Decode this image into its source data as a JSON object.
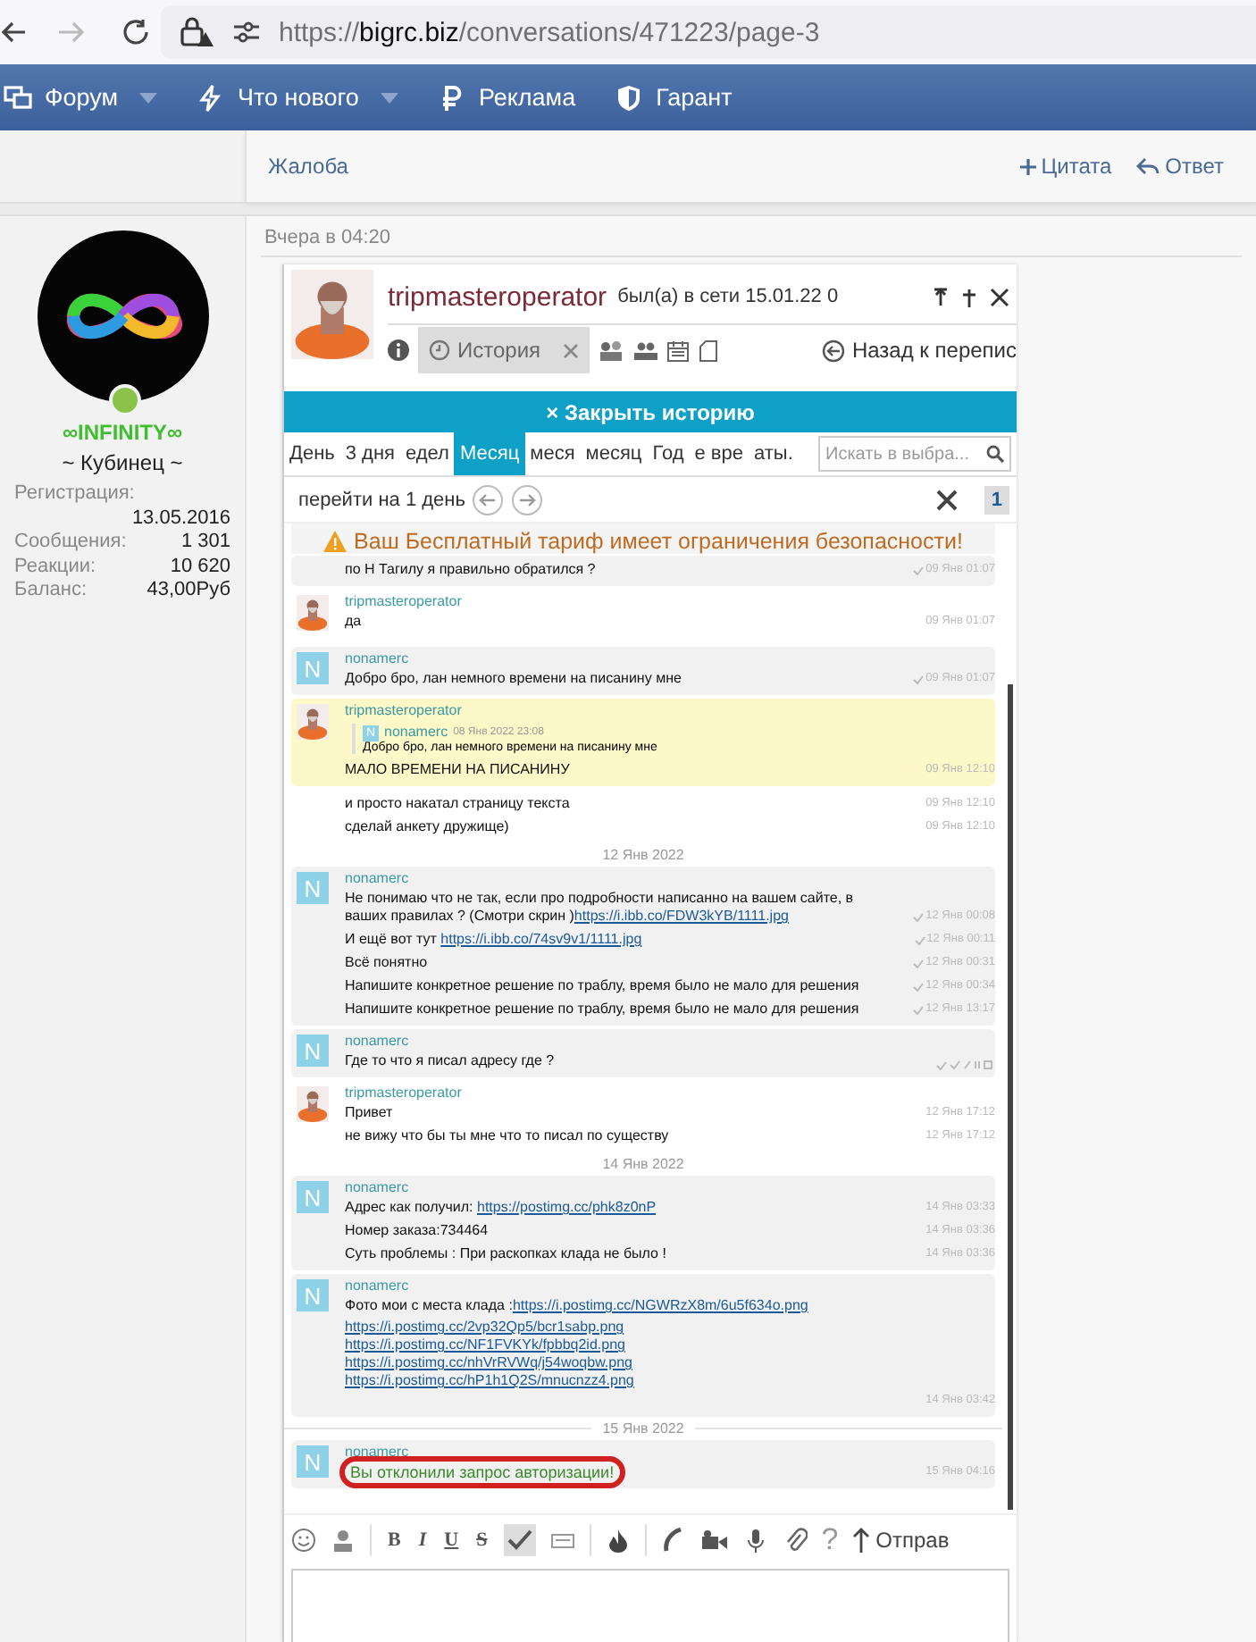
{
  "browser": {
    "url_scheme": "https://",
    "url_domain": "bigrc.biz",
    "url_path": "/conversations/471223/page-3",
    "forward_disabled": true
  },
  "nav": [
    {
      "label": "Форум",
      "dropdown": true
    },
    {
      "label": "Что нового",
      "dropdown": true
    },
    {
      "label": "Реклама",
      "dropdown": false
    },
    {
      "label": "Гарант",
      "dropdown": false
    }
  ],
  "prev_post": {
    "report": "Жалоба",
    "quote": "Цитата",
    "reply": "Ответ"
  },
  "user": {
    "name": "∞INFINITY∞",
    "title": "~ Кубинец ~",
    "online": true,
    "stats": [
      {
        "label": "Регистрация:",
        "value": "13.05.2016",
        "kind": "stacked"
      },
      {
        "label": "Сообщения:",
        "value": "1 301",
        "kind": "inline"
      },
      {
        "label": "Реакции:",
        "value": "10 620",
        "kind": "inline"
      },
      {
        "label": "Баланс:",
        "value": "43,00Руб",
        "kind": "inline"
      }
    ]
  },
  "post": {
    "date": "Вчера в 04:20"
  },
  "shot": {
    "contact": "tripmasteroperator",
    "status": "был(а) в сети 15.01.22 0",
    "history_tab": "История",
    "back": "Назад к перепис",
    "close_history": "× Закрыть историю",
    "periods": [
      {
        "label": "День",
        "selected": false
      },
      {
        "label": "3 дня",
        "selected": false
      },
      {
        "label": "едел",
        "selected": false
      },
      {
        "label": "Месяц",
        "selected": true
      },
      {
        "label": "меся",
        "selected": false
      },
      {
        "label": "месяц",
        "selected": false
      },
      {
        "label": "Год",
        "selected": false
      },
      {
        "label": "е вре",
        "selected": false
      },
      {
        "label": "аты.",
        "selected": false
      }
    ],
    "search": {
      "placeholder": "Искать в выбра..."
    },
    "jump": "перейти на 1 день",
    "page": "1",
    "warning": "Ваш Бесплатный тариф имеет ограничения безопасности!",
    "messages": [
      {
        "kind": "group",
        "highlighted": false,
        "shade": true,
        "lines": [
          {
            "text": "по Н Тагилу я правильно обратился ?",
            "time": "09 Янв 01:07",
            "read": true
          }
        ]
      },
      {
        "kind": "group",
        "sender": "tripmasteroperator",
        "avatar_picture": true,
        "highlighted": false,
        "shade": false,
        "lines": [
          {
            "text": "да",
            "time": "09 Янв 01:07",
            "read": false
          }
        ]
      },
      {
        "kind": "group",
        "sender": "nonamerc",
        "avatar_letter": "N",
        "highlighted": false,
        "shade": true,
        "lines": [
          {
            "text": "Добро бро, лан немного времени на писанину мне",
            "time": "09 Янв 01:07",
            "read": true
          }
        ]
      },
      {
        "kind": "group",
        "sender": "tripmasteroperator",
        "avatar_picture": true,
        "highlighted": true,
        "quote": {
          "letter": "N",
          "sender": "nonamerc",
          "time": "08 Янв 2022 23:08",
          "text": "Добро бро, лан немного времени на писанину мне"
        },
        "lines": [
          {
            "text": "МАЛО ВРЕМЕНИ НА ПИСАНИНУ",
            "time": "09 Янв 12:10",
            "read": false
          }
        ]
      },
      {
        "kind": "group",
        "highlighted": false,
        "shade": false,
        "lines": [
          {
            "text": "и просто накатал страницу текста",
            "time": "09 Янв 12:10",
            "read": false
          },
          {
            "text": "сделай анкету дружище)",
            "time": "09 Янв 12:10",
            "read": false
          }
        ]
      },
      {
        "kind": "date",
        "text": "12 Янв 2022"
      },
      {
        "kind": "group",
        "sender": "nonamerc",
        "avatar_letter": "N",
        "highlighted": false,
        "shade": true,
        "lines": [
          {
            "text": "Не понимаю что не так, если про подробности написанно на вашем сайте, в ваших правилах ? (Смотри скрин )",
            "link": "https://i.ibb.co/FDW3kYB/1111.jpg",
            "time": "12 Янв 00:08",
            "read": true
          },
          {
            "text": "И ещё вот тут ",
            "link": "https://i.ibb.co/74sv9v1/1111.jpg",
            "time": "12 Янв 00:11",
            "read": true
          },
          {
            "text": "Всё понятно",
            "time": "12 Янв 00:31",
            "read": true
          },
          {
            "text": "Напишите конкретное решение по траблу, время было не мало для решения",
            "time": "12 Янв 00:34",
            "read": true
          },
          {
            "text": "Напишите конкретное решение по траблу, время было не мало для решения",
            "time": "12 Янв 13:17",
            "read": true
          }
        ]
      },
      {
        "kind": "group",
        "sender": "nonamerc",
        "avatar_letter": "N",
        "highlighted": false,
        "shade": true,
        "lines": [
          {
            "text": "Где то что я писал адресу где ?",
            "read": true,
            "actions": true
          }
        ]
      },
      {
        "kind": "group",
        "sender": "tripmasteroperator",
        "avatar_picture": true,
        "highlighted": false,
        "shade": false,
        "lines": [
          {
            "text": "Привет",
            "time": "12 Янв 17:12",
            "read": false
          },
          {
            "text": "не вижу что бы ты мне что то писал по существу",
            "time": "12 Янв 17:12",
            "read": false
          }
        ]
      },
      {
        "kind": "date",
        "text": "14 Янв 2022"
      },
      {
        "kind": "group",
        "sender": "nonamerc",
        "avatar_letter": "N",
        "highlighted": false,
        "shade": true,
        "lines": [
          {
            "text": "Адрес как получил: ",
            "link": "https://postimg.cc/phk8z0nP",
            "time": "14 Янв 03:33",
            "read": false
          },
          {
            "text": "Номер заказа:734464",
            "time": "14 Янв 03:36",
            "read": false
          },
          {
            "text": "Суть проблемы : При раскопках клада не было !",
            "time": "14 Янв 03:36",
            "read": false
          }
        ]
      },
      {
        "kind": "group",
        "sender": "nonamerc",
        "avatar_letter": "N",
        "highlighted": false,
        "shade": true,
        "lines": [
          {
            "text": "Фото мои с места клада :",
            "link": "https://i.postimg.cc/NGWRzX8m/6u5f634o.png",
            "read": false
          },
          {
            "link": "https://i.postimg.cc/2vp32Qp5/bcr1sabp.png",
            "read": false
          },
          {
            "link": "https://i.postimg.cc/NF1FVKYk/fpbbq2id.png",
            "read": false
          },
          {
            "link": "https://i.postimg.cc/nhVrRVWq/j54woqbw.png",
            "read": false
          },
          {
            "link": "https://i.postimg.cc/hP1h1Q2S/mnucnzz4.png",
            "read": false
          },
          {
            "time": "14 Янв 03:42",
            "read": false
          }
        ]
      },
      {
        "kind": "date",
        "text": "15 Янв 2022"
      },
      {
        "kind": "group",
        "sender": "nonamerc",
        "avatar_letter": "N",
        "highlighted": false,
        "shade": true,
        "lines": [
          {
            "text": "Вы отклонили запрос авторизации!",
            "time": "15 Янв 04:16",
            "read": false,
            "system": true,
            "circled": true
          }
        ]
      }
    ],
    "composer": {
      "format": [
        "B",
        "I",
        "U",
        "S"
      ],
      "spellcheck_pressed": true,
      "help": "?",
      "send": "Отправ"
    }
  }
}
